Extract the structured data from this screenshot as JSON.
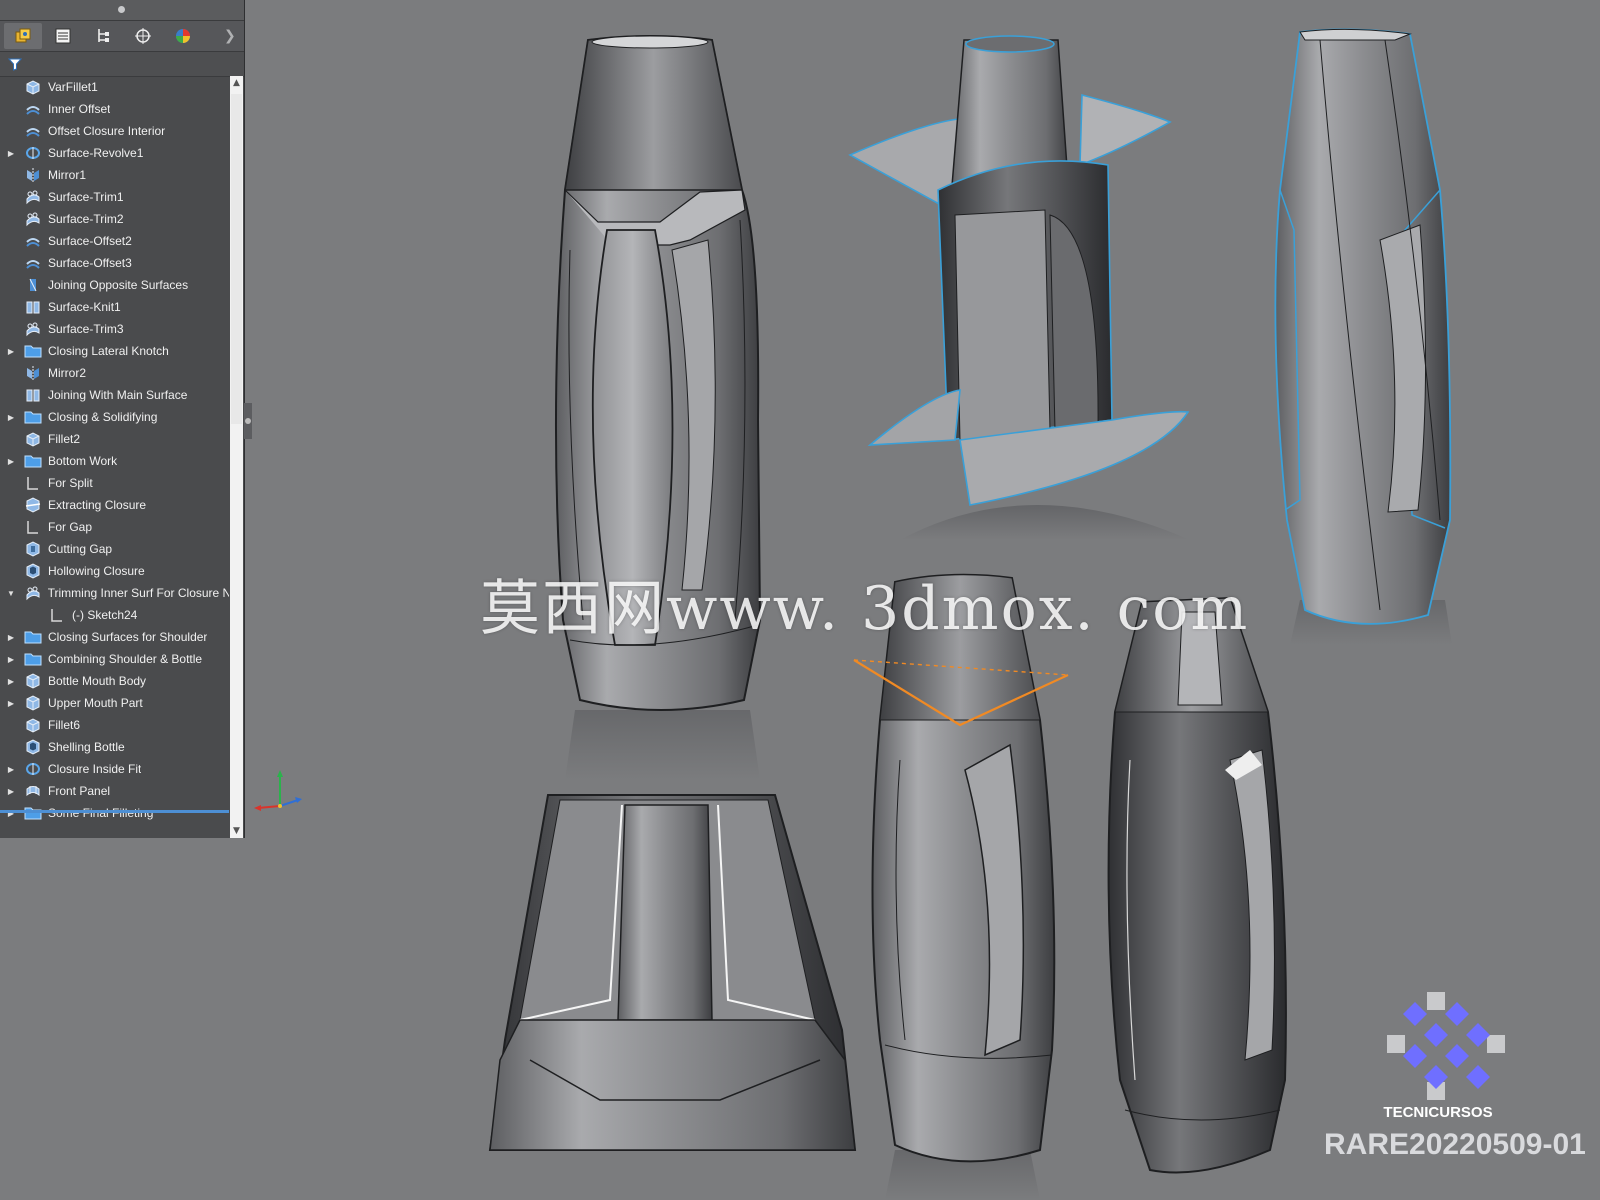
{
  "tabs": [
    {
      "name": "feature-manager",
      "icon": "featuremanager-icon"
    },
    {
      "name": "property-manager",
      "icon": "property-manager-icon"
    },
    {
      "name": "configuration-manager",
      "icon": "configuration-manager-icon"
    },
    {
      "name": "dimxpert-manager",
      "icon": "dimxpert-icon"
    },
    {
      "name": "display-manager",
      "icon": "display-manager-icon"
    }
  ],
  "tree": [
    {
      "label": "VarFillet1",
      "icon": "fillet-icon",
      "expandable": false
    },
    {
      "label": "Inner Offset",
      "icon": "offset-surface-icon",
      "expandable": false
    },
    {
      "label": "Offset Closure Interior",
      "icon": "offset-surface-icon",
      "expandable": false
    },
    {
      "label": "Surface-Revolve1",
      "icon": "revolve-surface-icon",
      "expandable": true
    },
    {
      "label": "Mirror1",
      "icon": "mirror-icon",
      "expandable": false
    },
    {
      "label": "Surface-Trim1",
      "icon": "trim-surface-icon",
      "expandable": false
    },
    {
      "label": "Surface-Trim2",
      "icon": "trim-surface-icon",
      "expandable": false
    },
    {
      "label": "Surface-Offset2",
      "icon": "offset-surface-icon",
      "expandable": false
    },
    {
      "label": "Surface-Offset3",
      "icon": "offset-surface-icon",
      "expandable": false
    },
    {
      "label": "Joining Opposite Surfaces",
      "icon": "ruled-surface-icon",
      "expandable": false
    },
    {
      "label": "Surface-Knit1",
      "icon": "knit-surface-icon",
      "expandable": false
    },
    {
      "label": "Surface-Trim3",
      "icon": "trim-surface-icon",
      "expandable": false
    },
    {
      "label": "Closing Lateral Knotch",
      "icon": "folder-icon",
      "expandable": true
    },
    {
      "label": "Mirror2",
      "icon": "mirror-icon",
      "expandable": false
    },
    {
      "label": "Joining With Main Surface",
      "icon": "knit-surface-icon",
      "expandable": false
    },
    {
      "label": "Closing & Solidifying",
      "icon": "folder-icon",
      "expandable": true
    },
    {
      "label": "Fillet2",
      "icon": "fillet-icon",
      "expandable": false
    },
    {
      "label": "Bottom Work",
      "icon": "folder-icon",
      "expandable": true
    },
    {
      "label": "For Split",
      "icon": "sketch-icon",
      "expandable": false
    },
    {
      "label": "Extracting Closure",
      "icon": "split-icon",
      "expandable": false
    },
    {
      "label": "For Gap",
      "icon": "sketch-icon",
      "expandable": false
    },
    {
      "label": "Cutting Gap",
      "icon": "cut-icon",
      "expandable": false
    },
    {
      "label": "Hollowing Closure",
      "icon": "shell-icon",
      "expandable": false
    },
    {
      "label": "Trimming Inner Surf For Closure N",
      "icon": "trim-surface-icon",
      "expandable": true,
      "expanded": true
    },
    {
      "label": "(-) Sketch24",
      "icon": "sketch-icon",
      "expandable": false,
      "child": true
    },
    {
      "label": "Closing Surfaces for Shoulder",
      "icon": "folder-icon",
      "expandable": true
    },
    {
      "label": "Combining Shoulder & Bottle",
      "icon": "folder-icon",
      "expandable": true
    },
    {
      "label": "Bottle Mouth Body",
      "icon": "extrude-icon",
      "expandable": true
    },
    {
      "label": "Upper Mouth Part",
      "icon": "extrude-icon",
      "expandable": true
    },
    {
      "label": "Fillet6",
      "icon": "fillet-icon",
      "expandable": false
    },
    {
      "label": "Shelling Bottle",
      "icon": "shell-icon",
      "expandable": false
    },
    {
      "label": "Closure Inside Fit",
      "icon": "revolve-surface-icon",
      "expandable": true
    },
    {
      "label": "Front Panel",
      "icon": "boundary-surface-icon",
      "expandable": true
    },
    {
      "label": "Some Final Filleting",
      "icon": "folder-icon",
      "expandable": true
    }
  ],
  "watermark": "莫西网www. 3dmox. com",
  "brand": {
    "name": "TECNICURSOS",
    "code": "RARE20220509-01"
  },
  "colors": {
    "viewport_bg": "#7b7c7e",
    "panel_bg": "#4a4b4d",
    "highlight": "#4d8fd4",
    "logo": "#6f6fff"
  }
}
